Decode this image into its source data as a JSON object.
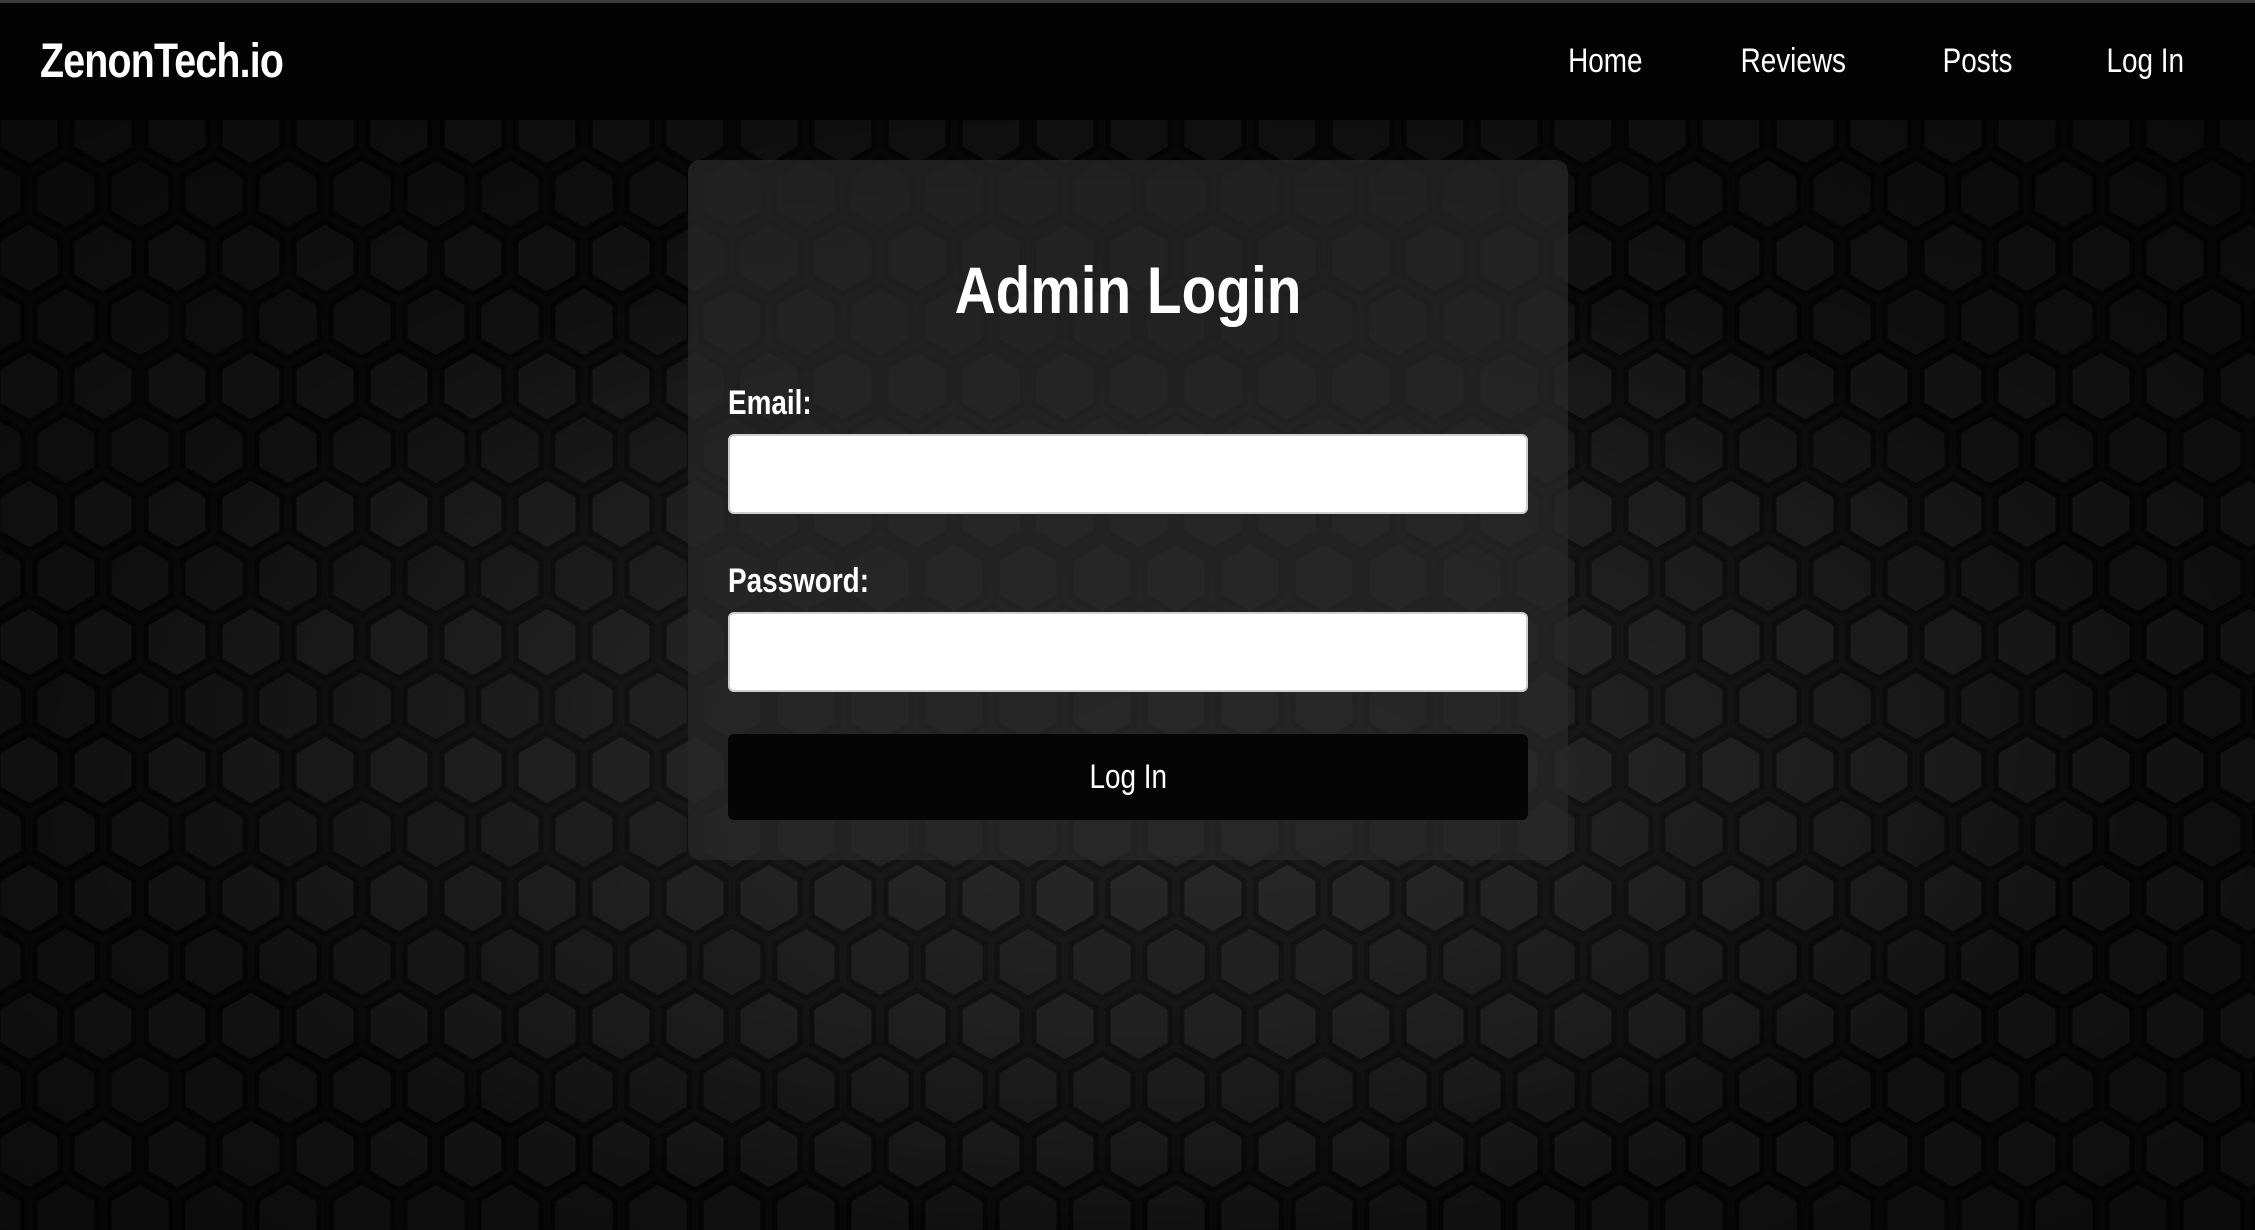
{
  "navbar": {
    "brand": "ZenonTech.io",
    "links": [
      {
        "label": "Home"
      },
      {
        "label": "Reviews"
      },
      {
        "label": "Posts"
      },
      {
        "label": "Log In"
      }
    ]
  },
  "login_form": {
    "title": "Admin Login",
    "email_label": "Email:",
    "email_value": "",
    "password_label": "Password:",
    "password_value": "",
    "submit_label": "Log In"
  },
  "colors": {
    "navbar_bg": "#030303",
    "page_bg": "#0c0c0c",
    "card_bg": "#282828",
    "button_bg": "#050505",
    "text": "#ffffff"
  },
  "background": {
    "pattern_icon": "hexagon-pattern"
  }
}
